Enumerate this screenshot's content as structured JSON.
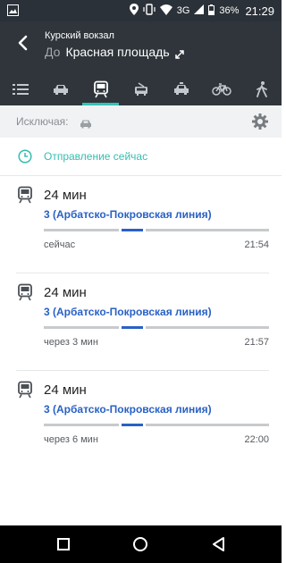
{
  "status_bar": {
    "network": "3G",
    "battery_percent": "36%",
    "time": "21:29",
    "icons": [
      "image-icon",
      "location-icon",
      "vibrate-icon",
      "wifi-icon",
      "signal-icon",
      "battery-icon"
    ]
  },
  "header": {
    "from": "Курский вокзал",
    "to_prefix": "До",
    "to": "Красная площадь",
    "icons": [
      "back-arrow-icon",
      "swap-icon"
    ]
  },
  "transport_tabs": [
    {
      "icon": "list-icon",
      "active": false
    },
    {
      "icon": "car-icon",
      "active": false
    },
    {
      "icon": "metro-icon",
      "active": true
    },
    {
      "icon": "bus-icon",
      "active": false
    },
    {
      "icon": "taxi-icon",
      "active": false
    },
    {
      "icon": "bicycle-icon",
      "active": false
    },
    {
      "icon": "walk-icon",
      "active": false
    }
  ],
  "exclude": {
    "label": "Исключая:",
    "excluded_icon": "car-icon",
    "settings_icon": "gear-icon"
  },
  "departure": {
    "label": "Отправление сейчас",
    "icon": "clock-icon"
  },
  "routes": [
    {
      "duration": "24 мин",
      "line": "3 (Арбатско-Покровская линия)",
      "depart_rel": "сейчас",
      "depart_time": "21:54"
    },
    {
      "duration": "24 мин",
      "line": "3 (Арбатско-Покровская линия)",
      "depart_rel": "через 3 мин",
      "depart_time": "21:57"
    },
    {
      "duration": "24 мин",
      "line": "3 (Арбатско-Покровская линия)",
      "depart_rel": "через 6 мин",
      "depart_time": "22:00"
    }
  ],
  "nav_bar": [
    "recents-square-icon",
    "home-circle-icon",
    "back-triangle-icon"
  ],
  "colors": {
    "header_bg": "#2f353b",
    "accent": "#35c3b5",
    "line_blue": "#2961c6",
    "walk_segment": "#c8cacd"
  }
}
